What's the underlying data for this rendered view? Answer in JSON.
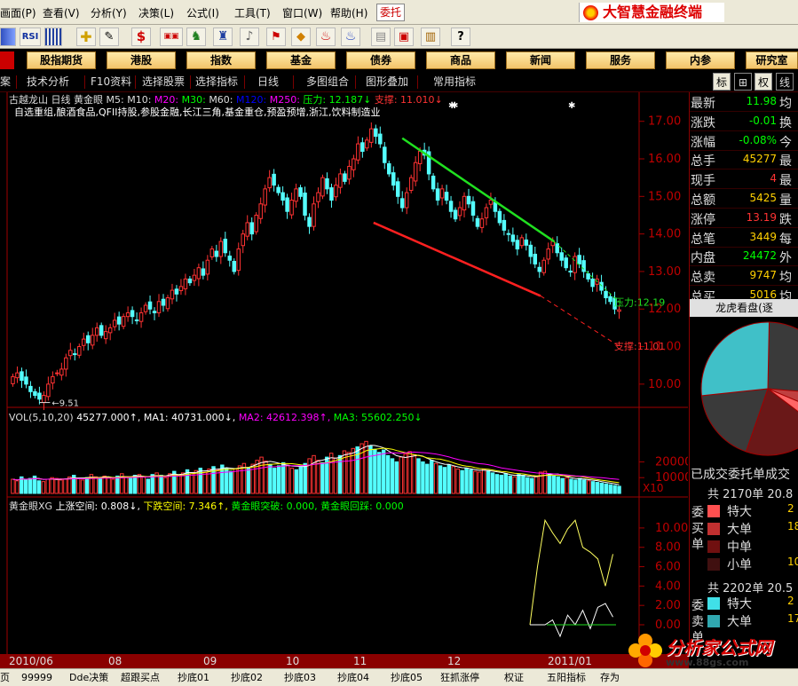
{
  "menubar": {
    "items": [
      "画面(P)",
      "查看(V)",
      "分析(Y)",
      "决策(L)",
      "公式(I)",
      "工具(T)",
      "窗口(W)",
      "帮助(H)",
      "委托"
    ],
    "brand": "大智慧金融终端"
  },
  "toolbar": {
    "items": [
      "RSI"
    ]
  },
  "categories": [
    "股指期货",
    "港股",
    "指数",
    "基金",
    "债券",
    "商品",
    "新闻",
    "服务",
    "内参",
    "研究室"
  ],
  "subbar": {
    "items": [
      "技术分析",
      "F10资料",
      "选择股票",
      "选择指标",
      "日线",
      "多图组合",
      "图形叠加",
      "常用指标"
    ],
    "right_tabs": [
      "标",
      "⊞",
      "权",
      "线"
    ]
  },
  "price_pane": {
    "title_parts": [
      {
        "text": "古越龙山",
        "color": "#dddddd"
      },
      {
        "text": "日线",
        "color": "#dddddd"
      },
      {
        "text": "黄金眼",
        "color": "#dddddd"
      },
      {
        "text": "M5:",
        "color": "#dddddd"
      },
      {
        "text": "M10:",
        "color": "#dddddd"
      },
      {
        "text": "M20:",
        "color": "#ff00ff"
      },
      {
        "text": "M30:",
        "color": "#00ff00"
      },
      {
        "text": "M60:",
        "color": "#dddddd"
      },
      {
        "text": "M120:",
        "color": "#0000ff"
      },
      {
        "text": "M250:",
        "color": "#ff00ff"
      },
      {
        "text": "压力: 12.187↓",
        "color": "#00ff00"
      },
      {
        "text": "支撑: 11.010↓",
        "color": "#ff3333"
      }
    ],
    "sectors": "自选重组,酿酒食品,QFII持股,参股金融,长江三角,基金重仓,预盈预增,浙江,饮料制造业",
    "y_ticks": [
      "17.00",
      "16.00",
      "15.00",
      "14.00",
      "13.00",
      "12.00",
      "11.00",
      "10.00"
    ],
    "low_label": "9.51",
    "high_label": "17.00",
    "pressure_label": "压力:12.19",
    "support_label": "支撑:11.01"
  },
  "vol_pane": {
    "title_parts": [
      {
        "text": "VOL(5,10,20)",
        "color": "#dddddd"
      },
      {
        "text": "45277.000↑,",
        "color": "#ffffff"
      },
      {
        "text": "MA1: 40731.000↓,",
        "color": "#ffffff"
      },
      {
        "text": "MA2: 42612.398↑,",
        "color": "#ff00ff"
      },
      {
        "text": "MA3: 55602.250↓",
        "color": "#00ff00"
      }
    ],
    "y_ticks": [
      "20000",
      "10000"
    ],
    "unit_label": "X10"
  },
  "ind_pane": {
    "title_parts": [
      {
        "text": "黄金眼XG",
        "color": "#dddddd"
      },
      {
        "text": "上涨空间: 0.808↓,",
        "color": "#ffffff"
      },
      {
        "text": "下跌空间: 7.346↑,",
        "color": "#ffff00"
      },
      {
        "text": "黄金眼突破: 0.000,",
        "color": "#00ff00"
      },
      {
        "text": "黄金眼回踩: 0.000",
        "color": "#00ff00"
      }
    ],
    "y_ticks": [
      "10.00",
      "8.00",
      "6.00",
      "4.00",
      "2.00",
      "0.00"
    ]
  },
  "x_axis": [
    "2010/06",
    "08",
    "09",
    "10",
    "11",
    "12",
    "2011/01"
  ],
  "quote": {
    "rows": [
      {
        "label": "最新",
        "value": "11.98",
        "color": "#00ff00",
        "right": "均"
      },
      {
        "label": "涨跌",
        "value": "-0.01",
        "color": "#00ff00",
        "right": "换"
      },
      {
        "label": "涨幅",
        "value": "-0.08%",
        "color": "#00ff00",
        "right": "今"
      },
      {
        "label": "总手",
        "value": "45277",
        "color": "#ffd000",
        "right": "最"
      },
      {
        "label": "现手",
        "value": "4",
        "color": "#ff3333",
        "right": "最"
      },
      {
        "label": "总额",
        "value": "5425",
        "color": "#ffd000",
        "right": "量"
      },
      {
        "label": "涨停",
        "value": "13.19",
        "color": "#ff3333",
        "right": "跌"
      },
      {
        "label": "总笔",
        "value": "3449",
        "color": "#ffd000",
        "right": "每"
      },
      {
        "label": "内盘",
        "value": "24472",
        "color": "#00ff00",
        "right": "外"
      },
      {
        "label": "总卖",
        "value": "9747",
        "color": "#ffd000",
        "right": "均"
      },
      {
        "label": "总买",
        "value": "5016",
        "color": "#ffd000",
        "right": "均"
      }
    ],
    "lhk_title": "龙虎看盘(逐",
    "pie": [
      {
        "value": 0.26,
        "color": "#3a3a3a"
      },
      {
        "value": 0.05,
        "color": "#c04040"
      },
      {
        "value": 0.04,
        "color": "#ff6666"
      },
      {
        "value": 0.2,
        "color": "#6a1818"
      },
      {
        "value": 0.18,
        "color": "#3a3a3a"
      },
      {
        "value": 0.27,
        "color": "#40c0c8"
      }
    ],
    "order_title": "已成交委托单成交",
    "buy": {
      "side": "委买单",
      "head": "共 2170单 20.8",
      "rows": [
        {
          "label": "特大",
          "value": "2",
          "color": "#ff5050"
        },
        {
          "label": "大单",
          "value": "18",
          "color": "#c03030"
        },
        {
          "label": "中单",
          "value": "",
          "color": "#701010"
        },
        {
          "label": "小单",
          "value": "10",
          "color": "#401010"
        }
      ]
    },
    "sell": {
      "side": "委卖单",
      "head": "共 2202单 20.5",
      "rows": [
        {
          "label": "特大",
          "value": "2",
          "color": "#40e0e8"
        },
        {
          "label": "大单",
          "value": "17",
          "color": "#30a8b0"
        }
      ]
    }
  },
  "bottom_tabs": [
    "页",
    "99999",
    "Dde决策",
    "超跟买点",
    "抄底01",
    "抄底02",
    "抄底03",
    "抄底04",
    "抄底05",
    "狂抓涨停",
    "权证",
    "五阳指标",
    "存为"
  ],
  "watermark": {
    "text": "分析家公式网",
    "url": "www.88gs.com"
  },
  "chart_data": [
    {
      "type": "candlestick",
      "title": "古越龙山 日线",
      "ylim": [
        9.5,
        17.3
      ],
      "pressure": 12.187,
      "support": 11.01,
      "low": 9.51,
      "x_categories": [
        "2010/06",
        "08",
        "09",
        "10",
        "11",
        "12",
        "2011/01"
      ],
      "close": [
        10.2,
        10.3,
        10.1,
        10.0,
        9.8,
        9.7,
        9.6,
        9.7,
        10.0,
        10.2,
        10.3,
        10.4,
        10.7,
        10.9,
        10.8,
        11.0,
        11.2,
        11.1,
        11.3,
        11.5,
        11.3,
        11.4,
        11.5,
        11.7,
        11.6,
        11.8,
        11.9,
        11.8,
        11.7,
        11.9,
        12.1,
        12.0,
        11.9,
        12.2,
        12.1,
        12.3,
        12.5,
        12.4,
        12.6,
        12.8,
        12.7,
        12.9,
        13.1,
        12.9,
        13.3,
        13.6,
        13.4,
        13.8,
        13.5,
        13.3,
        13.0,
        13.6,
        14.0,
        14.3,
        14.0,
        14.5,
        14.8,
        15.2,
        15.5,
        15.3,
        15.1,
        14.9,
        14.6,
        14.9,
        15.2,
        15.0,
        14.5,
        14.2,
        14.8,
        15.1,
        15.5,
        15.2,
        14.9,
        15.3,
        15.6,
        15.4,
        15.8,
        16.0,
        16.4,
        16.2,
        16.5,
        16.8,
        16.6,
        16.4,
        15.9,
        15.6,
        15.3,
        15.0,
        14.7,
        15.1,
        15.5,
        15.9,
        16.2,
        16.1,
        15.6,
        15.2,
        14.9,
        15.2,
        14.9,
        14.6,
        14.4,
        14.7,
        15.0,
        14.8,
        14.5,
        14.2,
        14.4,
        14.7,
        14.9,
        14.6,
        14.3,
        14.1,
        14.0,
        13.8,
        13.6,
        13.9,
        13.7,
        13.4,
        13.2,
        13.0,
        13.3,
        13.6,
        13.8,
        13.5,
        13.3,
        13.1,
        13.0,
        13.4,
        13.2,
        13.0,
        12.8,
        12.6,
        12.8,
        12.5,
        12.3,
        12.2,
        12.0,
        11.98
      ]
    },
    {
      "type": "bar",
      "title": "VOL(5,10,20)",
      "ylim": [
        0,
        45000
      ],
      "values": [
        9000,
        8000,
        10500,
        8500,
        9500,
        11000,
        8000,
        7500,
        9000,
        10000,
        9500,
        8500,
        9000,
        10500,
        11500,
        9500,
        8500,
        10000,
        12000,
        10500,
        9500,
        11000,
        10000,
        9000,
        11000,
        12500,
        10500,
        9500,
        11500,
        12000,
        10500,
        9000,
        12000,
        13000,
        11500,
        10000,
        12500,
        14000,
        11500,
        13000,
        15000,
        12500,
        14500,
        16000,
        13500,
        15500,
        17000,
        15000,
        18000,
        16000,
        14000,
        15500,
        17500,
        19000,
        16500,
        18500,
        21000,
        23000,
        20500,
        18500,
        16000,
        17500,
        19500,
        18000,
        16000,
        15000,
        17000,
        19000,
        22000,
        24000,
        21000,
        19500,
        23000,
        25500,
        22500,
        24000,
        27000,
        26000,
        28500,
        29500,
        31500,
        33000,
        30000,
        28000,
        26000,
        27500,
        24000,
        22000,
        20000,
        23000,
        25000,
        26500,
        24500,
        22000,
        20000,
        18500,
        21000,
        19000,
        17500,
        16500,
        18000,
        17000,
        15500,
        14500,
        16000,
        15000,
        14000,
        13500,
        15500,
        14500,
        13000,
        12000,
        11500,
        12500,
        11000,
        10500,
        12000,
        11500,
        10000,
        9500,
        10500,
        13500,
        14000,
        12500,
        11000,
        10500,
        9500,
        10000,
        9000,
        8500,
        9500,
        8500,
        8000,
        7500,
        7000,
        6500,
        6000,
        5500,
        5000,
        4527
      ]
    }
  ]
}
